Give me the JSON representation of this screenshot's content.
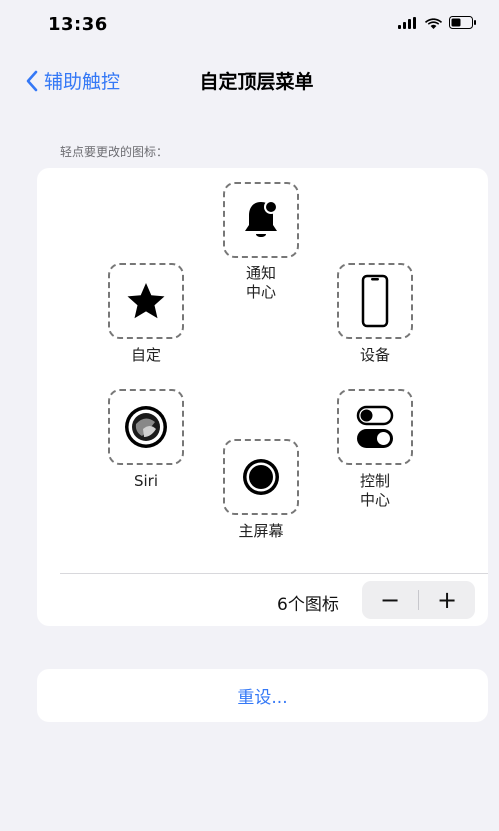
{
  "status": {
    "time": "13:36"
  },
  "nav": {
    "back_label": "辅助触控",
    "title": "自定顶层菜单"
  },
  "section": {
    "label": "轻点要更改的图标："
  },
  "menu_items": {
    "notification": {
      "line1": "通知",
      "line2": "中心"
    },
    "custom": {
      "label": "自定"
    },
    "device": {
      "label": "设备"
    },
    "siri": {
      "label": "Siri"
    },
    "control": {
      "line1": "控制",
      "line2": "中心"
    },
    "home": {
      "label": "主屏幕"
    }
  },
  "icon_count": {
    "label": "6个图标"
  },
  "stepper": {
    "minus": "−",
    "plus": "+"
  },
  "reset": {
    "label": "重设..."
  },
  "colors": {
    "accent": "#3478f6",
    "background": "#f2f2f7",
    "card": "#ffffff"
  },
  "icons": [
    "bell-icon",
    "star-icon",
    "phone-icon",
    "siri-icon",
    "toggle-icon",
    "home-button-icon",
    "signal-icon",
    "wifi-icon",
    "battery-icon",
    "chevron-left-icon"
  ]
}
